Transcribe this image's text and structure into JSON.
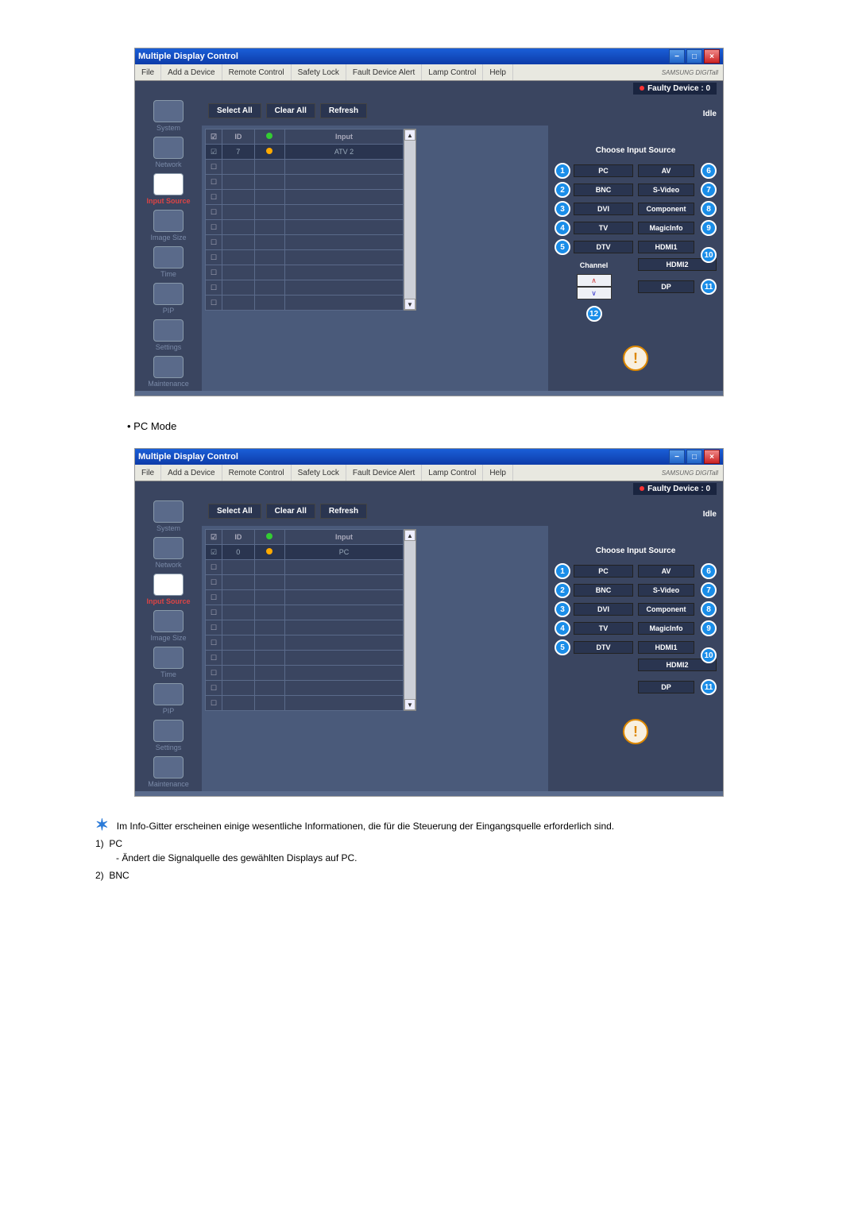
{
  "window_title": "Multiple Display Control",
  "menubar": [
    "File",
    "Add a Device",
    "Remote Control",
    "Safety Lock",
    "Fault Device Alert",
    "Lamp Control",
    "Help"
  ],
  "brand": "SAMSUNG DIGITall",
  "faulty_device": "Faulty Device : 0",
  "toolbar": {
    "select_all": "Select All",
    "clear_all": "Clear All",
    "refresh": "Refresh",
    "idle": "Idle"
  },
  "grid_headers": {
    "id": "ID",
    "input": "Input"
  },
  "grid_row1": {
    "id": "7",
    "input": "ATV 2"
  },
  "grid_row1_pc": {
    "id": "0",
    "input": "PC"
  },
  "sidebar": [
    "System",
    "Network",
    "Input Source",
    "Image Size",
    "Time",
    "PIP",
    "Settings",
    "Maintenance"
  ],
  "input_source": {
    "title": "Choose Input Source",
    "left": [
      "PC",
      "BNC",
      "DVI",
      "TV",
      "DTV"
    ],
    "right": [
      "AV",
      "S-Video",
      "Component",
      "MagicInfo",
      "HDMI1",
      "HDMI2",
      "DP"
    ],
    "channel_label": "Channel",
    "badges_left": [
      "1",
      "2",
      "3",
      "4",
      "5"
    ],
    "badges_right": [
      "6",
      "7",
      "8",
      "9",
      "10",
      "11"
    ],
    "badge_channel": "12"
  },
  "mode_label": "PC Mode",
  "notes": {
    "star_text": "Im Info-Gitter erscheinen einige wesentliche Informationen, die für die Steuerung der Eingangsquelle erforderlich sind.",
    "item1_num": "1)",
    "item1_label": "PC",
    "item1_sub": "- Ändert die Signalquelle des gewählten Displays auf PC.",
    "item2_num": "2)",
    "item2_label": "BNC"
  }
}
